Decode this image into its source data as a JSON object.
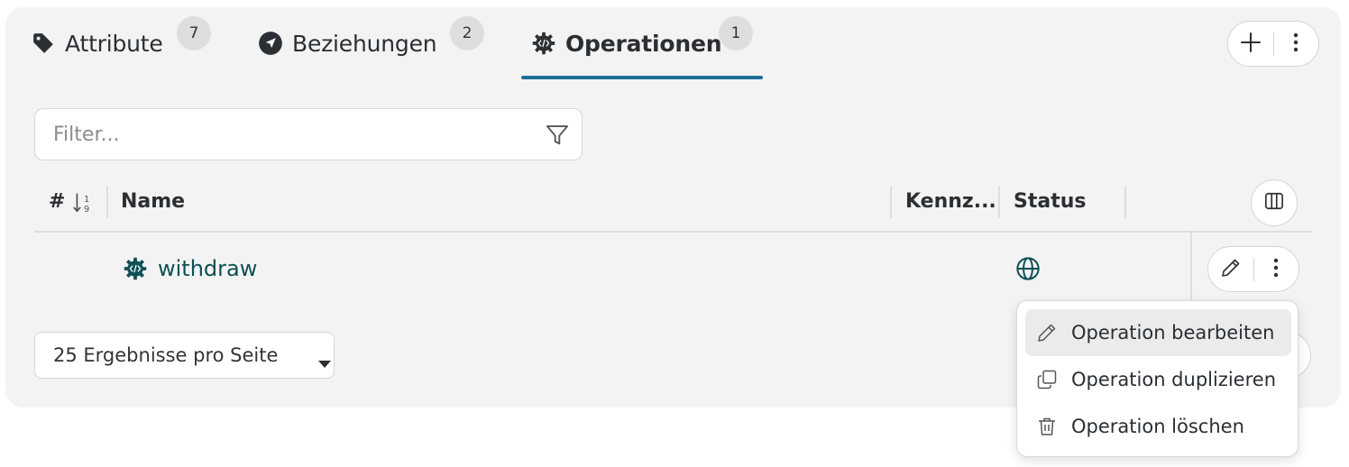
{
  "tabs": [
    {
      "label": "Attribute",
      "count": "7",
      "icon": "tag-icon"
    },
    {
      "label": "Beziehungen",
      "count": "2",
      "icon": "navigation-arrow-icon"
    },
    {
      "label": "Operationen",
      "count": "1",
      "icon": "operation-gear-code-icon",
      "active": true
    }
  ],
  "filter": {
    "placeholder": "Filter..."
  },
  "table": {
    "columns": [
      "#",
      "Name",
      "Kennz...",
      "Status"
    ],
    "rows": [
      {
        "name": "withdraw",
        "icon": "operation-gear-code-icon",
        "status_icon": "globe-icon"
      }
    ]
  },
  "pagination": {
    "page_size_label": "25 Ergebnisse pro Seite"
  },
  "row_menu": {
    "items": [
      {
        "label": "Operation bearbeiten",
        "icon": "pencil-icon"
      },
      {
        "label": "Operation duplizieren",
        "icon": "duplicate-icon"
      },
      {
        "label": "Operation löschen",
        "icon": "trash-icon"
      }
    ]
  },
  "colors": {
    "accent": "#1f6f94",
    "link": "#0f4f55",
    "panel": "#f3f3f3"
  }
}
